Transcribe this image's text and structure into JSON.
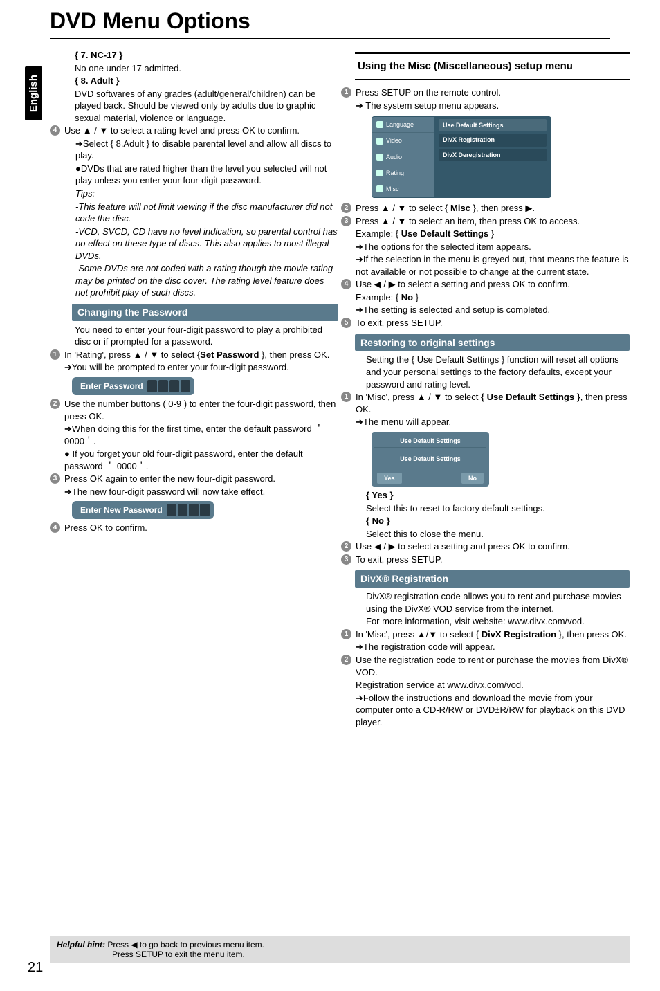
{
  "pageTitle": "DVD Menu Options",
  "sideTab": "English",
  "left": {
    "nc17_label": "{ 7. NC-17 }",
    "nc17_desc": "No one under 17 admitted.",
    "adult_label": "{ 8. Adult }",
    "adult_desc": "DVD softwares of any grades (adult/general/children) can be played back. Should be viewed only by adults due to graphic sexual material, violence or language.",
    "step4a": "Use ▲ / ▼ to select a rating level and press OK to confirm.",
    "step4b": "➔Select { 8.Adult } to disable parental level and allow all discs to play.",
    "step4c": "●DVDs that are rated higher than the level you selected will not play unless you enter your four-digit password.",
    "tips_label": "Tips:",
    "tip1": "-This feature will not limit viewing if the disc manufacturer did not code the disc.",
    "tip2": "-VCD, SVCD, CD have no level indication, so parental control has no effect on these type of discs. This also applies to most illegal DVDs.",
    "tip3": "-Some DVDs are not coded with a rating though the movie rating may be printed on the disc cover. The rating level feature does not prohibit play of such discs.",
    "changing_pw_header": "Changing the Password",
    "changing_pw_1": "You need to enter your four-digit password to play a prohibited disc or if prompted for a password.",
    "cp_step1": "In 'Rating', press ▲ / ▼ to select {Set Password }, then press OK.",
    "cp_step1b": "➔You will be prompted to enter your four-digit password.",
    "enter_pw_label": "Enter Password",
    "cp_step2": "Use the number buttons ( 0-9 ) to enter the four-digit password, then press OK.",
    "cp_step2b": "➔When doing this for the first time, enter the default password ＇0000＇.",
    "cp_step2c": "● If you forget your old four-digit password, enter the default  password ＇ 0000＇.",
    "cp_step3": "Press OK again to enter the new four-digit password.",
    "cp_step3b": "➔The new four-digit password will now take effect.",
    "enter_new_pw_label": "Enter New Password",
    "cp_step4": "Press OK to confirm."
  },
  "right": {
    "misc_heading": "Using the Misc (Miscellaneous) setup menu",
    "m_step1": "Press SETUP on the remote control.",
    "m_step1b": "➔ The system setup menu appears.",
    "menu_left": [
      "Language",
      "Video",
      "Audio",
      "Rating",
      "Misc"
    ],
    "menu_right": [
      "Use Default Settings",
      "DivX Registration",
      "DivX Deregistration"
    ],
    "m_step2": "Press ▲ / ▼ to select { Misc }, then press ▶.",
    "m_step3": "Press ▲ / ▼ to select an item, then press OK to access.",
    "m_step3b": "Example: { Use Default Settings }",
    "m_step3c": "➔The options for the selected item appears.",
    "m_step3d": "➔If the selection in the menu is greyed out, that means the feature is not available or not possible to change at the current state.",
    "m_step4": "Use ◀ / ▶ to select a setting and press OK to confirm.",
    "m_step4b": "Example: { No }",
    "m_step4c": "➔The setting is selected and setup is completed.",
    "m_step5": "To exit, press SETUP.",
    "restore_header": "Restoring to original settings",
    "r_intro": "Setting the { Use Default Settings } function will reset all options and your personal settings to the factory defaults, except your password and rating level.",
    "r_step1": "In 'Misc', press ▲ / ▼ to select { Use Default Settings }, then press OK.",
    "r_step1b": "➔The menu will appear.",
    "small_menu_hdr": "Use Default Settings",
    "small_menu_body": "Use Default Settings",
    "small_menu_yes": "Yes",
    "small_menu_no": "No",
    "r_yes": "{ Yes }",
    "r_yes_desc": "Select this to reset to factory default settings.",
    "r_no": "{ No }",
    "r_no_desc": "Select this to close the menu.",
    "r_step2": "Use ◀ / ▶ to select a setting and press OK to confirm.",
    "r_step3": "To exit, press SETUP.",
    "divx_header": "DivX® Registration",
    "divx_1": "DivX® registration code allows you to rent and purchase movies using the DivX® VOD service from the internet.",
    "divx_2": "For more information, visit website: www.divx.com/vod.",
    "d_step1": "In 'Misc', press ▲/▼ to select { DivX Registration }, then press OK.",
    "d_step1b": "➔The registration code will appear.",
    "d_step2": "Use the registration code to rent or purchase the movies from DivX® VOD.",
    "d_step2b": "Registration service at www.divx.com/vod.",
    "d_step2c": "➔Follow the instructions and download the movie from your computer onto a CD-R/RW or DVD±R/RW for playback on this DVD player."
  },
  "footer": {
    "hint_label": "Helpful hint:",
    "hint1": "  Press ◀ to go back to previous menu item.",
    "hint2": "Press SETUP to exit the menu item."
  },
  "pageNum": "21"
}
